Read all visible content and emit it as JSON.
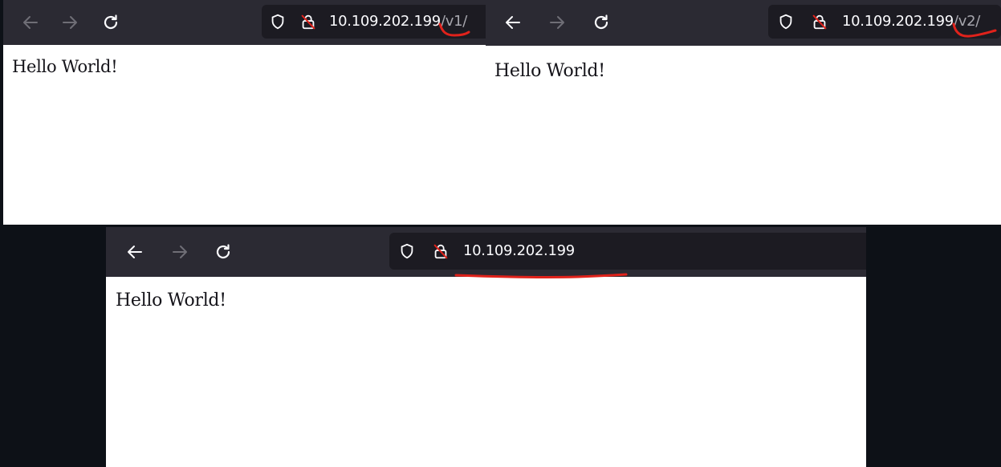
{
  "windows": [
    {
      "id": "v1",
      "url_host": "10.109.202.199",
      "url_path": "/v1/",
      "page_text": "Hello World!"
    },
    {
      "id": "v2",
      "url_host": "10.109.202.199",
      "url_path": "/v2/",
      "page_text": "Hello World!"
    },
    {
      "id": "root",
      "url_host": "10.109.202.199",
      "url_path": "",
      "page_text": "Hello World!"
    }
  ],
  "icons": {
    "back": "back-arrow-icon",
    "forward": "forward-arrow-icon",
    "reload": "reload-icon",
    "tracking": "shield-icon",
    "security": "insecure-lock-icon"
  },
  "colors": {
    "toolbar": "#2b2a33",
    "urlbar": "#1c1b22",
    "url_text": "#fbfbfe",
    "url_path": "#a6a6ad",
    "annotation": "#e0221b",
    "backdrop": "#0d1117"
  }
}
